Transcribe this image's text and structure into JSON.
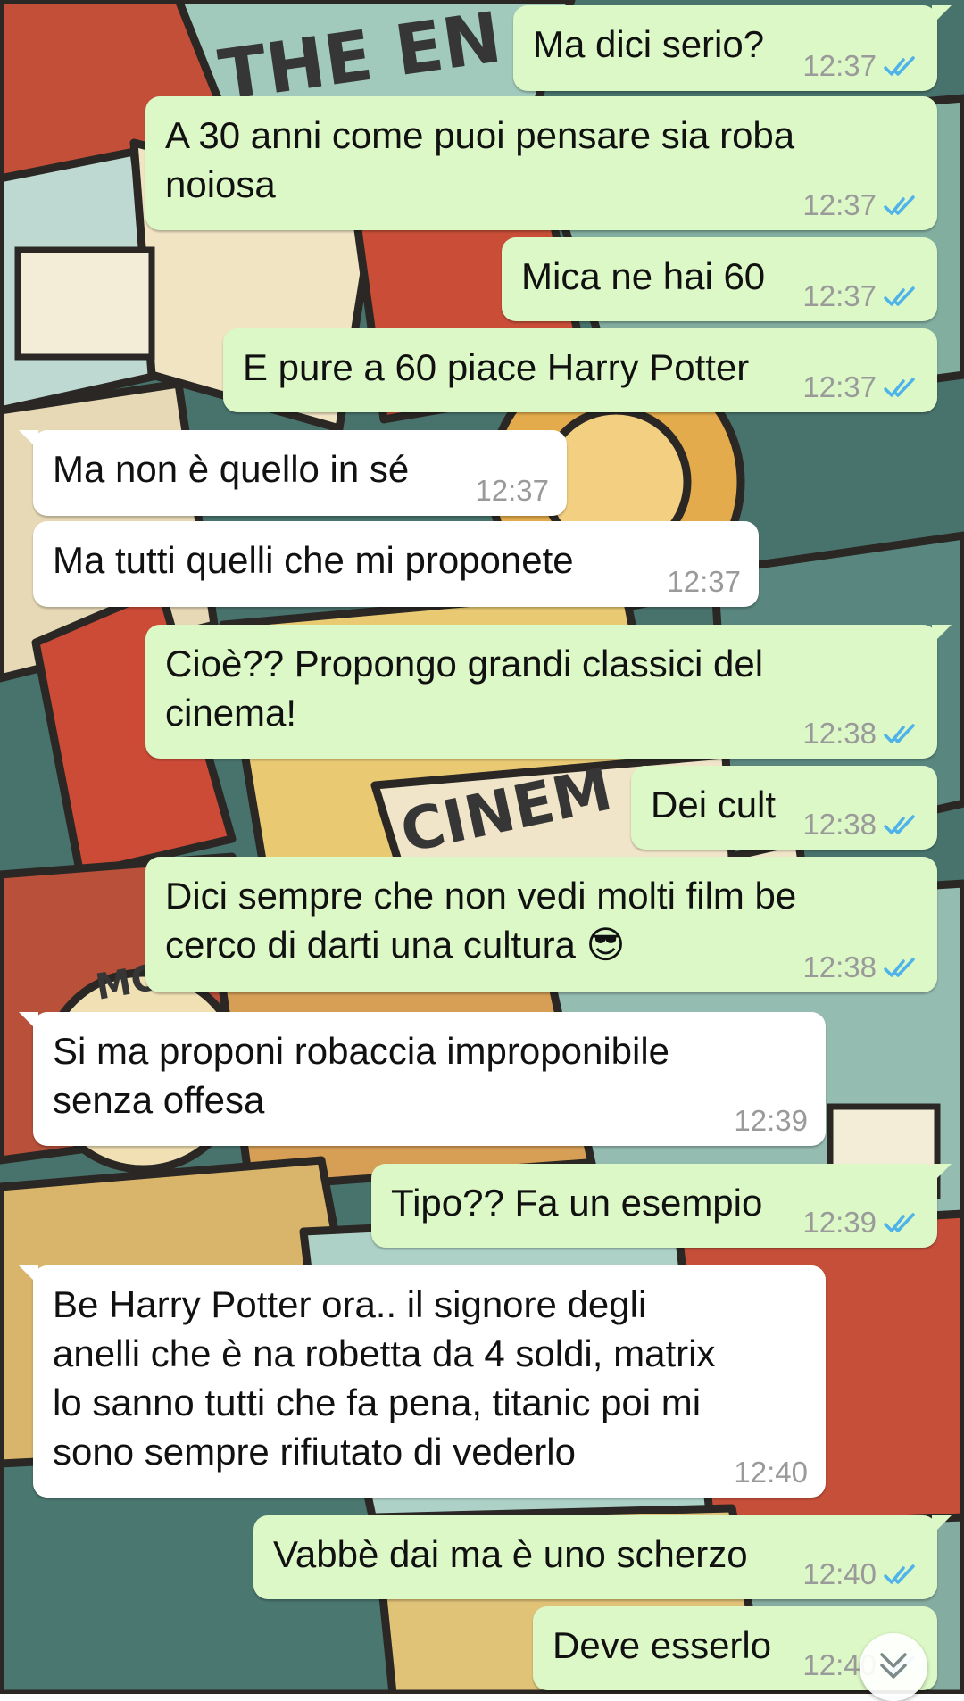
{
  "theme": {
    "sent_bubble": "#dcf8c6",
    "received_bubble": "#ffffff",
    "read_ticks": "#4fb3ea",
    "timestamp": "#9a9a9a"
  },
  "messages": [
    {
      "direction": "sent",
      "text": "Ma dici serio?",
      "time": "12:37",
      "status": "read"
    },
    {
      "direction": "sent",
      "text": "A 30 anni come puoi pensare sia roba\nnoiosa",
      "time": "12:37",
      "status": "read"
    },
    {
      "direction": "sent",
      "text": "Mica ne hai 60",
      "time": "12:37",
      "status": "read"
    },
    {
      "direction": "sent",
      "text": "E pure a 60 piace Harry Potter",
      "time": "12:37",
      "status": "read"
    },
    {
      "direction": "received",
      "text": "Ma non è quello in sé",
      "time": "12:37"
    },
    {
      "direction": "received",
      "text": "Ma tutti quelli che mi proponete",
      "time": "12:37"
    },
    {
      "direction": "sent",
      "text": "Cioè?? Propongo grandi classici del\ncinema!",
      "time": "12:38",
      "status": "read"
    },
    {
      "direction": "sent",
      "text": "Dei cult",
      "time": "12:38",
      "status": "read"
    },
    {
      "direction": "sent",
      "text": "Dici sempre che non vedi molti film be\ncerco di darti una cultura 😎",
      "time": "12:38",
      "status": "read"
    },
    {
      "direction": "received",
      "text": "Si ma proponi robaccia improponibile\nsenza offesa",
      "time": "12:39"
    },
    {
      "direction": "sent",
      "text": "Tipo?? Fa un esempio",
      "time": "12:39",
      "status": "read"
    },
    {
      "direction": "received",
      "text": "Be Harry Potter ora.. il signore degli\nanelli che è na robetta da 4 soldi, matrix\nlo sanno tutti che fa pena, titanic poi mi\nsono sempre rifiutato di vederlo",
      "time": "12:40"
    },
    {
      "direction": "sent",
      "text": "Vabbè dai ma è uno scherzo",
      "time": "12:40",
      "status": "read"
    },
    {
      "direction": "sent",
      "text": "Deve esserlo",
      "time": "12:40",
      "status": "read"
    }
  ],
  "wallpaper_text": {
    "sign_top": "THE EN",
    "sign_middle": "CINEM",
    "sign_left": "MO"
  },
  "scroll_button_icon": "double-chevron-down-icon"
}
